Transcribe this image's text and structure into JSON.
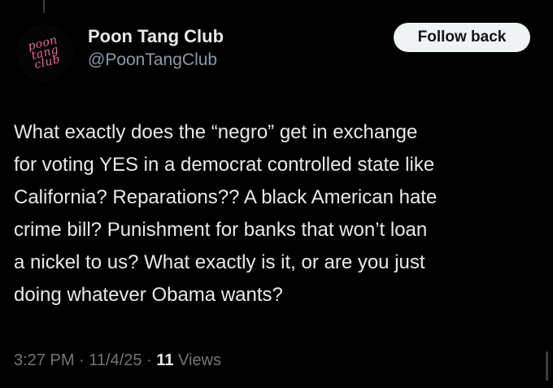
{
  "author": {
    "display_name": "Poon Tang Club",
    "handle": "@PoonTangClub",
    "avatar_logo_lines": [
      "poon",
      "tang",
      "club"
    ]
  },
  "follow_button_label": "Follow back",
  "tweet": {
    "text": "What exactly does the “negro” get in exchange\nfor voting YES in a democrat controlled state like\nCalifornia? Reparations?? A black American hate\ncrime bill? Punishment for banks that won’t loan\na nickel to us? What exactly is it, or are you just\ndoing whatever Obama wants?",
    "time": "3:27 PM",
    "date": "11/4/25",
    "views_count": "11",
    "views_label": "Views"
  },
  "colors": {
    "background": "#000000",
    "text": "#e7e9ea",
    "secondary": "#71767b",
    "logo_pink": "#e8689a"
  }
}
